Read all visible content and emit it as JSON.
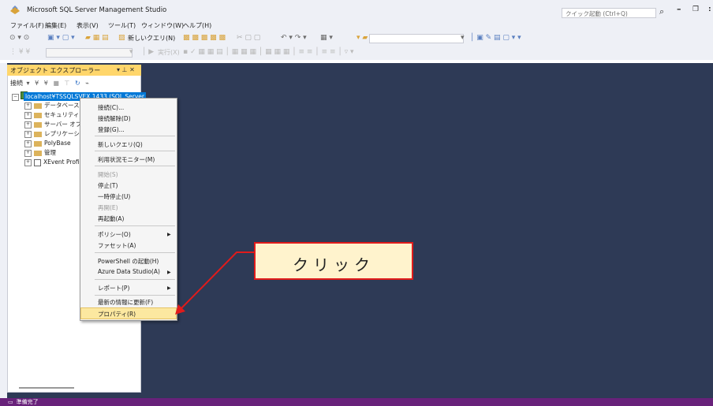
{
  "window": {
    "title": "Microsoft SQL Server Management Studio",
    "quick_launch_placeholder": "クイック起動 (Ctrl+Q)"
  },
  "menu": [
    "ファイル(F)",
    "編集(E)",
    "表示(V)",
    "ツール(T)",
    "ウィンドウ(W)",
    "ヘルプ(H)"
  ],
  "toolbar": {
    "new_query_label": "新しいクエリ(N)",
    "execute_label": "実行(X)"
  },
  "object_explorer": {
    "title": "オブジェクト エクスプローラー",
    "connect_label": "接続",
    "server_node": "localhost¥TSSQLSVEX,1433 (SQL Server",
    "nodes": [
      "データベース",
      "セキュリティ",
      "サーバー オブジェ",
      "レプリケーション",
      "PolyBase",
      "管理",
      "XEvent Profil"
    ]
  },
  "context_menu": {
    "items": [
      {
        "label": "接続(C)...",
        "enabled": true
      },
      {
        "label": "接続解除(D)",
        "enabled": true
      },
      {
        "label": "登録(G)...",
        "enabled": true
      },
      {
        "label": "新しいクエリ(Q)",
        "enabled": true
      },
      {
        "label": "利用状況モニター(M)",
        "enabled": true
      },
      {
        "label": "開始(S)",
        "enabled": false
      },
      {
        "label": "停止(T)",
        "enabled": true
      },
      {
        "label": "一時停止(U)",
        "enabled": true
      },
      {
        "label": "再開(E)",
        "enabled": false
      },
      {
        "label": "再起動(A)",
        "enabled": true
      },
      {
        "label": "ポリシー(O)",
        "enabled": true,
        "submenu": true
      },
      {
        "label": "ファセット(A)",
        "enabled": true
      },
      {
        "label": "PowerShell の起動(H)",
        "enabled": true
      },
      {
        "label": "Azure Data Studio(A)",
        "enabled": true,
        "submenu": true
      },
      {
        "label": "レポート(P)",
        "enabled": true,
        "submenu": true
      },
      {
        "label": "最新の情報に更新(F)",
        "enabled": true
      },
      {
        "label": "プロパティ(R)",
        "enabled": true,
        "highlighted": true
      }
    ]
  },
  "callout": {
    "text": "クリック",
    "border_color": "#e01b1b",
    "fill_color": "#fff3cd"
  },
  "status": {
    "text": "準備完了",
    "color": "#68217a"
  },
  "colors": {
    "workspace": "#2e3a56",
    "selection": "#0078d7",
    "panel_tab": "#ffd66b"
  }
}
